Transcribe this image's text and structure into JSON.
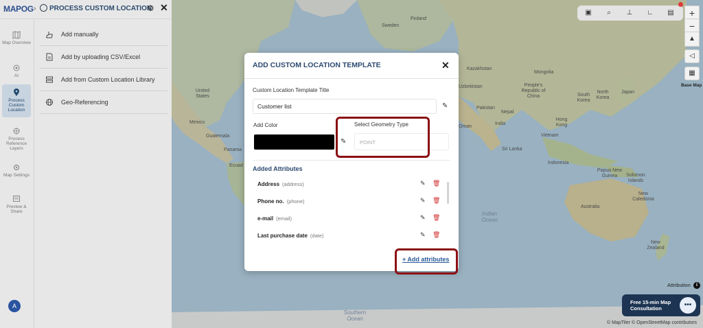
{
  "app": {
    "logo": "MAPOG",
    "crumb_title": "PROCESS CUSTOM LOCATION"
  },
  "rail": {
    "items": [
      {
        "label": "Map Overview"
      },
      {
        "label": "AI"
      },
      {
        "label": "Process Custom Location"
      },
      {
        "label": "Process Reference Layers"
      },
      {
        "label": "Map Settings"
      },
      {
        "label": "Preview & Share"
      }
    ],
    "avatar": "A"
  },
  "panel": {
    "items": [
      {
        "label": "Add manually"
      },
      {
        "label": "Add by uploading CSV/Excel"
      },
      {
        "label": "Add from Custom Location Library"
      },
      {
        "label": "Geo-Referencing"
      }
    ]
  },
  "map": {
    "base_map_label": "Base Map",
    "attribution": "Attribution",
    "consult_text": "Free 15-min Map Consultation",
    "copyright": "© MapTiler © OpenStreetMap contributors",
    "labels": {
      "sweden": "Sweden",
      "finland": "Finland",
      "kazakhstan": "Kazakhstan",
      "mongolia": "Mongolia",
      "uzbekistan": "Uzbekistan",
      "china": "People's Republic of China",
      "north_korea": "North Korea",
      "south_korea": "South Korea",
      "japan": "Japan",
      "pakistan": "Pakistan",
      "nepal": "Nepal",
      "india": "India",
      "oman": "Oman",
      "hong_kong": "Hong Kong",
      "vietnam": "Vietnam",
      "sri_lanka": "Sri Lanka",
      "indonesia": "Indonesia",
      "png": "Papua New Guinea",
      "solomon": "Solomon Islands",
      "australia": "Australia",
      "new_caledonia": "New Caledonia",
      "new_zealand": "New Zealand",
      "united_states": "United States",
      "mexico": "Mexico",
      "guatemala": "Guatemala",
      "panama": "Panama",
      "ecuador": "Ecuad",
      "indian_ocean": "Indian Ocean",
      "southern_ocean": "Southern Ocean"
    }
  },
  "modal": {
    "title": "ADD CUSTOM LOCATION TEMPLATE",
    "template_title_label": "Custom Location Template Title",
    "template_title_value": "Customer list",
    "add_color_label": "Add Color",
    "color_value": "#000000",
    "geometry_label": "Select Geometry Type",
    "geometry_value": "POINT",
    "attributes_heading": "Added Attributes",
    "attributes": [
      {
        "name": "Address",
        "key": "(address)"
      },
      {
        "name": "Phone no.",
        "key": "(phone)"
      },
      {
        "name": "e-mail",
        "key": "(email)"
      },
      {
        "name": "Last purchase date",
        "key": "(date)"
      }
    ],
    "add_attributes": "+ Add attributes"
  },
  "colors": {
    "highlight": "#8b0f14",
    "accent": "#2d4a70",
    "delete": "#d03030"
  }
}
